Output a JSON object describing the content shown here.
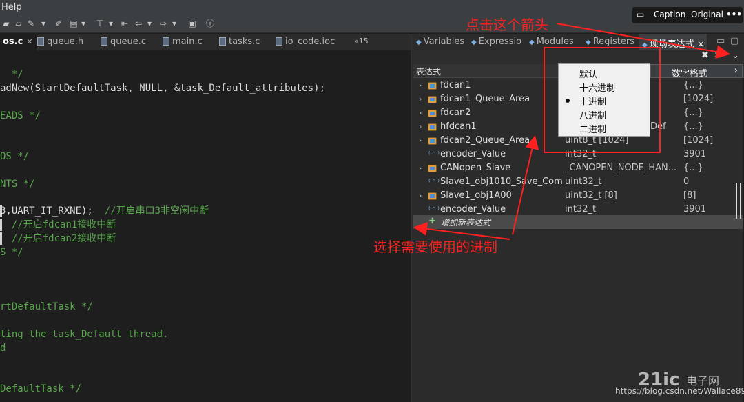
{
  "menubar": {
    "help": "Help"
  },
  "editor": {
    "tabs": [
      {
        "label": "os.c",
        "active": true
      },
      {
        "label": "queue.h"
      },
      {
        "label": "queue.c"
      },
      {
        "label": "main.c"
      },
      {
        "label": "tasks.c"
      },
      {
        "label": "io_code.ioc"
      },
      {
        "label": "»15"
      }
    ],
    "lines": [
      {
        "text": "  */",
        "kind": "comment"
      },
      {
        "text": "adNew(StartDefaultTask, NULL, &task_Default_attributes);",
        "kind": "plain"
      },
      {
        "text": "EADS */",
        "kind": "comment"
      },
      {
        "text": "OS */",
        "kind": "comment"
      },
      {
        "text": "NTS */",
        "kind": "comment"
      },
      {
        "text": "3,UART_IT_RXNE);  //开启串口3非空闲中断",
        "kind": "mixed",
        "code": "3,UART_IT_RXNE);  ",
        "comment": "//开启串口3非空闲中断"
      },
      {
        "text": "  //开启fdcan1接收中断",
        "kind": "comment"
      },
      {
        "text": "  //开启fdcan2接收中断",
        "kind": "comment"
      },
      {
        "text": "S */",
        "kind": "comment"
      },
      {
        "text": "rtDefaultTask */",
        "kind": "comment"
      },
      {
        "text": "ting the task_Default thread.",
        "kind": "comment"
      },
      {
        "text": "d",
        "kind": "comment"
      },
      {
        "text": "DefaultTask */",
        "kind": "comment"
      }
    ]
  },
  "panel": {
    "tabs": [
      {
        "label": "Variables"
      },
      {
        "label": "Expressio"
      },
      {
        "label": "Modules"
      },
      {
        "label": "Registers"
      },
      {
        "label": "现场表达式",
        "active": true
      }
    ],
    "column_expression": "表达式",
    "rows": [
      {
        "name": "fdcan1",
        "type": "",
        "value": "{...}",
        "icon": "struct",
        "expandable": true
      },
      {
        "name": "fdcan1_Queue_Area",
        "type": "",
        "value": "[1024]",
        "icon": "struct",
        "expandable": true
      },
      {
        "name": "fdcan2",
        "type": "",
        "value": "{...}",
        "icon": "struct",
        "expandable": true
      },
      {
        "name": "hfdcan1",
        "type": "Def",
        "value": "{...}",
        "icon": "struct",
        "expandable": true
      },
      {
        "name": "fdcan2_Queue_Area",
        "type": "uint8_t [1024]",
        "value": "[1024]",
        "icon": "struct",
        "expandable": true
      },
      {
        "name": "encoder_Value",
        "type": "int32_t",
        "value": "3901",
        "icon": "primitive",
        "expandable": false
      },
      {
        "name": "CANopen_Slave",
        "type": "_CANOPEN_NODE_HAN...",
        "value": "{...}",
        "icon": "struct",
        "expandable": true
      },
      {
        "name": "Slave1_obj1010_Save_Comm",
        "type": "uint32_t",
        "value": "0",
        "icon": "primitive",
        "expandable": false
      },
      {
        "name": "Slave1_obj1A00",
        "type": "uint32_t [8]",
        "value": "[8]",
        "icon": "struct",
        "expandable": true
      },
      {
        "name": "encoder_Value",
        "type": "int32_t",
        "value": "3901",
        "icon": "primitive",
        "expandable": false
      }
    ],
    "add_expression": "增加新表达式"
  },
  "context_menu": {
    "entry": "数字格式",
    "options": [
      {
        "label": "默认",
        "selected": false
      },
      {
        "label": "十六进制",
        "selected": false
      },
      {
        "label": "十进制",
        "selected": true
      },
      {
        "label": "八进制",
        "selected": false
      },
      {
        "label": "二进制",
        "selected": false
      }
    ]
  },
  "annotations": {
    "top": "点击这个箭头",
    "middle": "选择需要使用的进制"
  },
  "viewer": {
    "caption": "Caption",
    "original": "Original",
    "more": "•••"
  },
  "watermark": {
    "logo": "21ic",
    "site": "电子网",
    "url": "https://blog.csdn.net/Wallace89"
  },
  "colors": {
    "annotation": "#ff2020",
    "comment": "#57a64a"
  }
}
